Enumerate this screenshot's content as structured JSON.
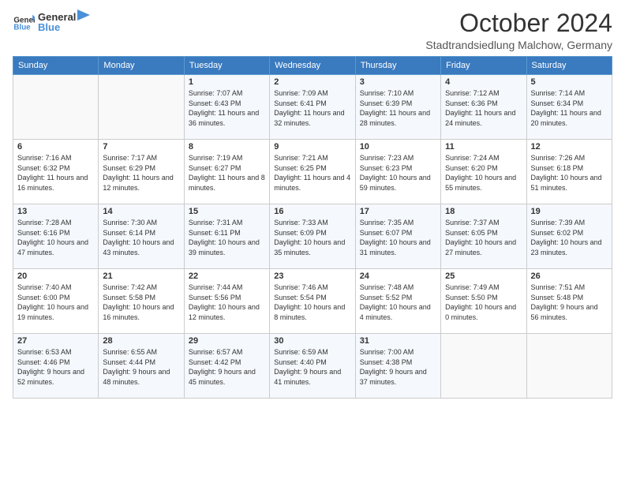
{
  "header": {
    "logo_line1": "General",
    "logo_line2": "Blue",
    "month": "October 2024",
    "location": "Stadtrandsiedlung Malchow, Germany"
  },
  "days_of_week": [
    "Sunday",
    "Monday",
    "Tuesday",
    "Wednesday",
    "Thursday",
    "Friday",
    "Saturday"
  ],
  "weeks": [
    [
      {
        "day": "",
        "sunrise": "",
        "sunset": "",
        "daylight": ""
      },
      {
        "day": "",
        "sunrise": "",
        "sunset": "",
        "daylight": ""
      },
      {
        "day": "1",
        "sunrise": "Sunrise: 7:07 AM",
        "sunset": "Sunset: 6:43 PM",
        "daylight": "Daylight: 11 hours and 36 minutes."
      },
      {
        "day": "2",
        "sunrise": "Sunrise: 7:09 AM",
        "sunset": "Sunset: 6:41 PM",
        "daylight": "Daylight: 11 hours and 32 minutes."
      },
      {
        "day": "3",
        "sunrise": "Sunrise: 7:10 AM",
        "sunset": "Sunset: 6:39 PM",
        "daylight": "Daylight: 11 hours and 28 minutes."
      },
      {
        "day": "4",
        "sunrise": "Sunrise: 7:12 AM",
        "sunset": "Sunset: 6:36 PM",
        "daylight": "Daylight: 11 hours and 24 minutes."
      },
      {
        "day": "5",
        "sunrise": "Sunrise: 7:14 AM",
        "sunset": "Sunset: 6:34 PM",
        "daylight": "Daylight: 11 hours and 20 minutes."
      }
    ],
    [
      {
        "day": "6",
        "sunrise": "Sunrise: 7:16 AM",
        "sunset": "Sunset: 6:32 PM",
        "daylight": "Daylight: 11 hours and 16 minutes."
      },
      {
        "day": "7",
        "sunrise": "Sunrise: 7:17 AM",
        "sunset": "Sunset: 6:29 PM",
        "daylight": "Daylight: 11 hours and 12 minutes."
      },
      {
        "day": "8",
        "sunrise": "Sunrise: 7:19 AM",
        "sunset": "Sunset: 6:27 PM",
        "daylight": "Daylight: 11 hours and 8 minutes."
      },
      {
        "day": "9",
        "sunrise": "Sunrise: 7:21 AM",
        "sunset": "Sunset: 6:25 PM",
        "daylight": "Daylight: 11 hours and 4 minutes."
      },
      {
        "day": "10",
        "sunrise": "Sunrise: 7:23 AM",
        "sunset": "Sunset: 6:23 PM",
        "daylight": "Daylight: 10 hours and 59 minutes."
      },
      {
        "day": "11",
        "sunrise": "Sunrise: 7:24 AM",
        "sunset": "Sunset: 6:20 PM",
        "daylight": "Daylight: 10 hours and 55 minutes."
      },
      {
        "day": "12",
        "sunrise": "Sunrise: 7:26 AM",
        "sunset": "Sunset: 6:18 PM",
        "daylight": "Daylight: 10 hours and 51 minutes."
      }
    ],
    [
      {
        "day": "13",
        "sunrise": "Sunrise: 7:28 AM",
        "sunset": "Sunset: 6:16 PM",
        "daylight": "Daylight: 10 hours and 47 minutes."
      },
      {
        "day": "14",
        "sunrise": "Sunrise: 7:30 AM",
        "sunset": "Sunset: 6:14 PM",
        "daylight": "Daylight: 10 hours and 43 minutes."
      },
      {
        "day": "15",
        "sunrise": "Sunrise: 7:31 AM",
        "sunset": "Sunset: 6:11 PM",
        "daylight": "Daylight: 10 hours and 39 minutes."
      },
      {
        "day": "16",
        "sunrise": "Sunrise: 7:33 AM",
        "sunset": "Sunset: 6:09 PM",
        "daylight": "Daylight: 10 hours and 35 minutes."
      },
      {
        "day": "17",
        "sunrise": "Sunrise: 7:35 AM",
        "sunset": "Sunset: 6:07 PM",
        "daylight": "Daylight: 10 hours and 31 minutes."
      },
      {
        "day": "18",
        "sunrise": "Sunrise: 7:37 AM",
        "sunset": "Sunset: 6:05 PM",
        "daylight": "Daylight: 10 hours and 27 minutes."
      },
      {
        "day": "19",
        "sunrise": "Sunrise: 7:39 AM",
        "sunset": "Sunset: 6:02 PM",
        "daylight": "Daylight: 10 hours and 23 minutes."
      }
    ],
    [
      {
        "day": "20",
        "sunrise": "Sunrise: 7:40 AM",
        "sunset": "Sunset: 6:00 PM",
        "daylight": "Daylight: 10 hours and 19 minutes."
      },
      {
        "day": "21",
        "sunrise": "Sunrise: 7:42 AM",
        "sunset": "Sunset: 5:58 PM",
        "daylight": "Daylight: 10 hours and 16 minutes."
      },
      {
        "day": "22",
        "sunrise": "Sunrise: 7:44 AM",
        "sunset": "Sunset: 5:56 PM",
        "daylight": "Daylight: 10 hours and 12 minutes."
      },
      {
        "day": "23",
        "sunrise": "Sunrise: 7:46 AM",
        "sunset": "Sunset: 5:54 PM",
        "daylight": "Daylight: 10 hours and 8 minutes."
      },
      {
        "day": "24",
        "sunrise": "Sunrise: 7:48 AM",
        "sunset": "Sunset: 5:52 PM",
        "daylight": "Daylight: 10 hours and 4 minutes."
      },
      {
        "day": "25",
        "sunrise": "Sunrise: 7:49 AM",
        "sunset": "Sunset: 5:50 PM",
        "daylight": "Daylight: 10 hours and 0 minutes."
      },
      {
        "day": "26",
        "sunrise": "Sunrise: 7:51 AM",
        "sunset": "Sunset: 5:48 PM",
        "daylight": "Daylight: 9 hours and 56 minutes."
      }
    ],
    [
      {
        "day": "27",
        "sunrise": "Sunrise: 6:53 AM",
        "sunset": "Sunset: 4:46 PM",
        "daylight": "Daylight: 9 hours and 52 minutes."
      },
      {
        "day": "28",
        "sunrise": "Sunrise: 6:55 AM",
        "sunset": "Sunset: 4:44 PM",
        "daylight": "Daylight: 9 hours and 48 minutes."
      },
      {
        "day": "29",
        "sunrise": "Sunrise: 6:57 AM",
        "sunset": "Sunset: 4:42 PM",
        "daylight": "Daylight: 9 hours and 45 minutes."
      },
      {
        "day": "30",
        "sunrise": "Sunrise: 6:59 AM",
        "sunset": "Sunset: 4:40 PM",
        "daylight": "Daylight: 9 hours and 41 minutes."
      },
      {
        "day": "31",
        "sunrise": "Sunrise: 7:00 AM",
        "sunset": "Sunset: 4:38 PM",
        "daylight": "Daylight: 9 hours and 37 minutes."
      },
      {
        "day": "",
        "sunrise": "",
        "sunset": "",
        "daylight": ""
      },
      {
        "day": "",
        "sunrise": "",
        "sunset": "",
        "daylight": ""
      }
    ]
  ]
}
